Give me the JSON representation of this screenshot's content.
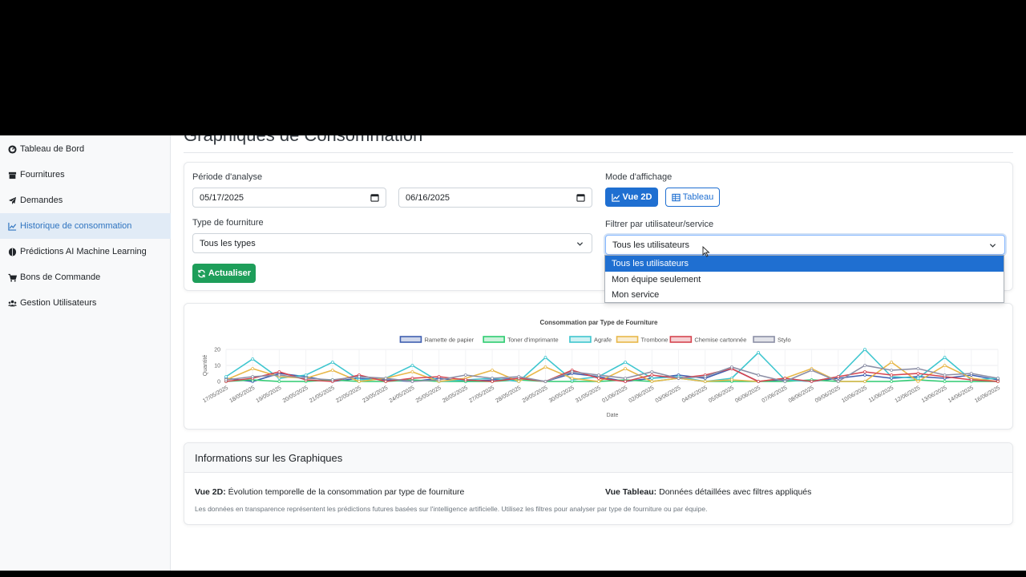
{
  "sidebar": {
    "items": [
      {
        "label": "Tableau de Bord",
        "icon": "gauge-icon",
        "active": false
      },
      {
        "label": "Fournitures",
        "icon": "box-icon",
        "active": false
      },
      {
        "label": "Demandes",
        "icon": "paper-plane-icon",
        "active": false
      },
      {
        "label": "Historique de consommation",
        "icon": "line-chart-icon",
        "active": true
      },
      {
        "label": "Prédictions AI Machine Learning",
        "icon": "brain-icon",
        "active": false
      },
      {
        "label": "Bons de Commande",
        "icon": "cart-icon",
        "active": false
      },
      {
        "label": "Gestion Utilisateurs",
        "icon": "users-icon",
        "active": false
      }
    ]
  },
  "page": {
    "title": "Graphiques de Consommation"
  },
  "filters": {
    "period_label": "Période d'analyse",
    "date_start": "05/17/2025",
    "date_end": "06/16/2025",
    "type_label": "Type de fourniture",
    "type_value": "Tous les types",
    "refresh_label": "Actualiser",
    "mode_label": "Mode d'affichage",
    "mode_2d_label": "Vue 2D",
    "mode_table_label": "Tableau",
    "user_filter_label": "Filtrer par utilisateur/service",
    "user_filter_value": "Tous les utilisateurs",
    "user_filter_options": [
      "Tous les utilisateurs",
      "Mon équipe seulement",
      "Mon service"
    ]
  },
  "colors": {
    "primary": "#1f6fd1",
    "success": "#1e9e5a",
    "active_nav_bg": "#e1ebf6",
    "active_nav_text": "#2f74c0"
  },
  "chart_data": {
    "type": "line",
    "title": "Consommation par Type de Fourniture",
    "xlabel": "Date",
    "ylabel": "Quantité",
    "ylim": [
      0,
      20
    ],
    "yticks": [
      0,
      10,
      20
    ],
    "legend_position": "top",
    "grid": true,
    "x": [
      "17/05/2025",
      "18/05/2025",
      "19/05/2025",
      "20/05/2025",
      "21/05/2025",
      "22/05/2025",
      "23/05/2025",
      "24/05/2025",
      "25/05/2025",
      "26/05/2025",
      "27/05/2025",
      "28/05/2025",
      "29/05/2025",
      "30/05/2025",
      "31/05/2025",
      "01/06/2025",
      "02/06/2025",
      "03/06/2025",
      "04/06/2025",
      "05/06/2025",
      "06/06/2025",
      "07/06/2025",
      "08/06/2025",
      "09/06/2025",
      "10/06/2025",
      "11/06/2025",
      "12/06/2025",
      "13/06/2025",
      "14/06/2025",
      "16/06/2025"
    ],
    "series": [
      {
        "name": "Ramette de papier",
        "color": "#3f5fb0",
        "values": [
          2,
          0,
          5,
          3,
          0,
          2,
          1,
          0,
          2,
          0,
          1,
          2,
          0,
          5,
          3,
          0,
          2,
          4,
          2,
          8,
          0,
          1,
          0,
          2,
          4,
          2,
          3,
          2,
          4,
          1
        ]
      },
      {
        "name": "Toner d'imprimante",
        "color": "#2ecc71",
        "values": [
          0,
          1,
          0,
          0,
          1,
          0,
          0,
          1,
          0,
          0,
          0,
          1,
          0,
          0,
          0,
          1,
          0,
          2,
          0,
          0,
          0,
          0,
          1,
          0,
          0,
          0,
          1,
          0,
          0,
          0
        ]
      },
      {
        "name": "Agrafe",
        "color": "#3fc6cf",
        "values": [
          3,
          14,
          2,
          4,
          12,
          1,
          2,
          10,
          0,
          1,
          2,
          0,
          15,
          1,
          3,
          12,
          2,
          3,
          0,
          2,
          18,
          1,
          0,
          3,
          20,
          3,
          2,
          15,
          1,
          2
        ]
      },
      {
        "name": "Trombone",
        "color": "#e8b84a",
        "values": [
          1,
          8,
          3,
          2,
          7,
          0,
          2,
          6,
          0,
          2,
          7,
          0,
          9,
          2,
          0,
          8,
          0,
          2,
          0,
          1,
          0,
          2,
          8,
          0,
          0,
          12,
          0,
          10,
          2,
          0
        ]
      },
      {
        "name": "Chemise cartonnée",
        "color": "#d64550",
        "values": [
          0,
          2,
          6,
          1,
          0,
          4,
          0,
          2,
          3,
          1,
          0,
          2,
          0,
          7,
          2,
          0,
          4,
          2,
          4,
          8,
          0,
          2,
          0,
          3,
          6,
          4,
          5,
          3,
          1,
          0
        ]
      },
      {
        "name": "Stylo",
        "color": "#8c8fa6",
        "values": [
          1,
          3,
          4,
          2,
          1,
          3,
          2,
          0,
          1,
          4,
          2,
          3,
          0,
          6,
          4,
          2,
          6,
          2,
          3,
          9,
          4,
          0,
          7,
          0,
          10,
          7,
          8,
          4,
          5,
          2
        ]
      }
    ]
  },
  "info": {
    "title": "Informations sur les Graphiques",
    "vue2d_label": "Vue 2D:",
    "vue2d_text": " Évolution temporelle de la consommation par type de fourniture",
    "vuetableau_label": "Vue Tableau:",
    "vuetableau_text": " Données détaillées avec filtres appliqués",
    "note": "Les données en transparence représentent les prédictions futures basées sur l'intelligence artificielle. Utilisez les filtres pour analyser par type de fourniture ou par équipe."
  }
}
